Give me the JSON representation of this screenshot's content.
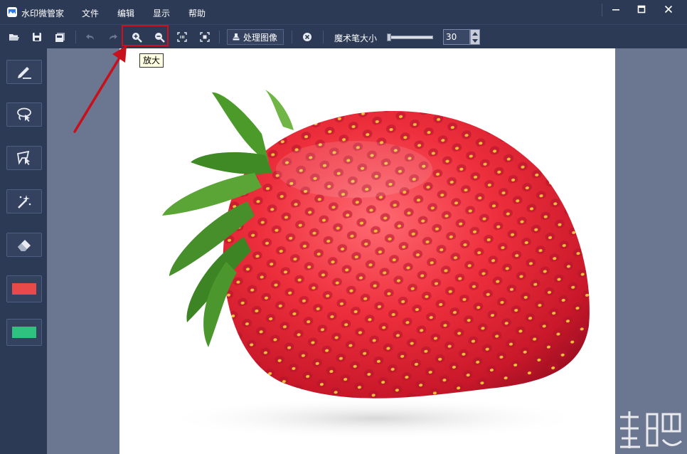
{
  "app": {
    "title": "水印微管家",
    "menu": [
      "文件",
      "编辑",
      "显示",
      "帮助"
    ]
  },
  "toolbar": {
    "buttons": [
      "open-icon",
      "save-icon",
      "save-as-icon",
      "undo-icon",
      "redo-icon",
      "zoom-in-icon",
      "zoom-out-icon",
      "actual-size-icon",
      "fit-window-icon"
    ],
    "process_label": "处理图像",
    "brush_size_label": "魔术笔大小",
    "brush_size_value": "30",
    "brush_slider_level": 0.0
  },
  "tooltip": {
    "text": "放大"
  },
  "sidebar": {
    "tools": [
      "pen-icon",
      "lasso-icon",
      "polygon-select-icon",
      "magic-wand-icon",
      "eraser-icon"
    ],
    "colors": {
      "primary": "#e84a4a",
      "secondary": "#2ec27e"
    }
  },
  "colors": {
    "chrome": "#2c3a55",
    "canvas_bg": "#6b7690",
    "highlight": "#d0101c"
  }
}
